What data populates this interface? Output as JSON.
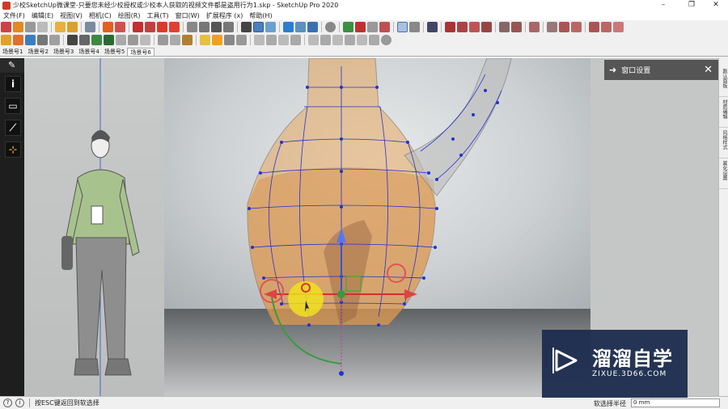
{
  "window": {
    "title": "少校SketchUp微课堂-只要您未经少校授权或少校本人获取的视频文件都是盗用行为1.skp - SketchUp Pro 2020",
    "minimize": "–",
    "maximize": "❐",
    "close": "✕"
  },
  "menu": [
    "文件(F)",
    "编辑(E)",
    "视图(V)",
    "相机(C)",
    "绘图(R)",
    "工具(T)",
    "窗口(W)",
    "扩展程序 (x)",
    "帮助(H)"
  ],
  "scenes": [
    "场景号1",
    "场景号2",
    "场景号3",
    "场景号4",
    "场景号5",
    "场景号6"
  ],
  "active_scene_index": 5,
  "left_tools": [
    "i",
    "▭",
    "⟋",
    "⊹"
  ],
  "panel": {
    "title": "窗口设置",
    "arrow": "➜",
    "close": "✕"
  },
  "right_tabs": [
    "默认面板",
    "材质编辑",
    "风格样式",
    "雾化设置"
  ],
  "status": {
    "help_icon": "?",
    "info_icon": "i",
    "message": "按ESC键返回到软选择",
    "field_label": "软选择半径",
    "field_value": "0 mm"
  },
  "watermark": {
    "title": "溜溜自学",
    "subtitle": "ZIXUE.3D66.COM"
  },
  "colors": {
    "accent": "#1e3a6e",
    "selection_blue": "#2233cc",
    "glass_amber": "#d89a50"
  }
}
